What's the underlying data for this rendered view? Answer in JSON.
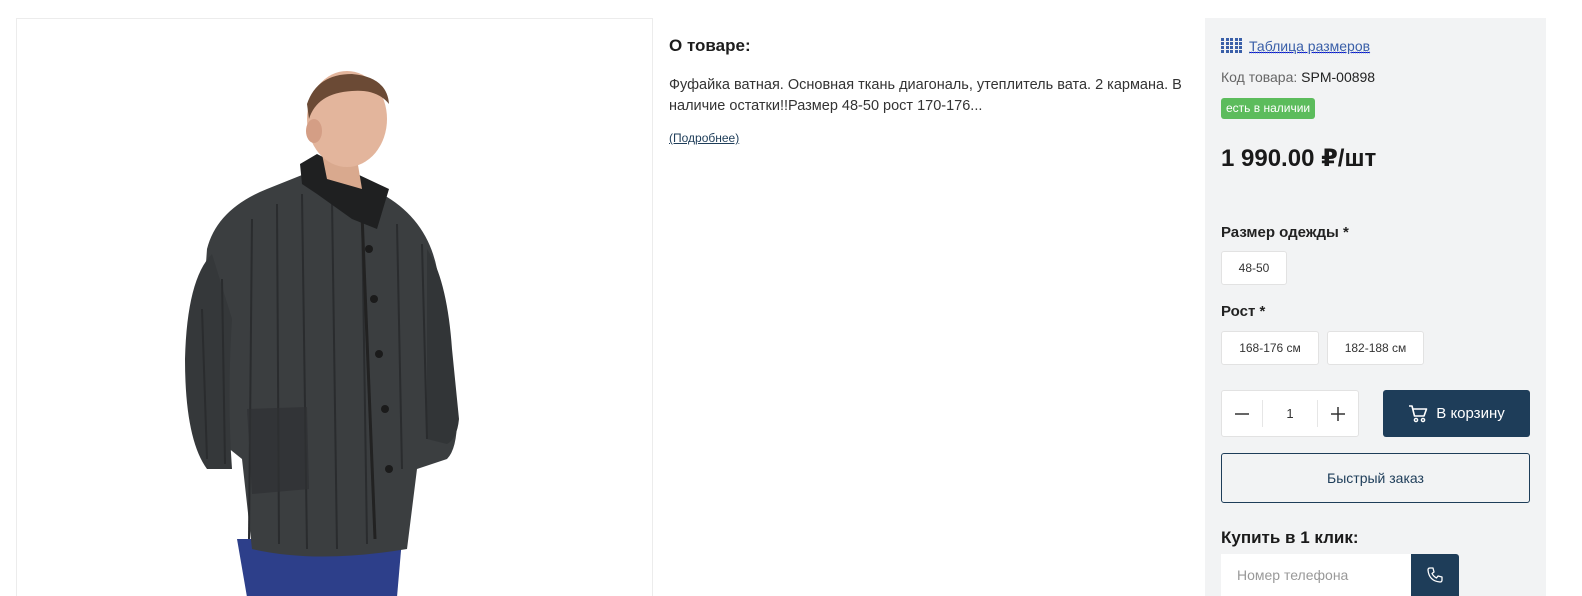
{
  "product_image": {
    "alt": ""
  },
  "about": {
    "title": "О товаре:",
    "text": "Фуфайка ватная. Основная ткань диагональ, утеплитель вата. 2 кармана. В наличие остатки!!Размер 48-50 рост 170-176...",
    "more_link": "(Подробнее)"
  },
  "panel": {
    "size_table_link": "Таблица размеров",
    "size_table_icon": "grid-icon",
    "sku_label": "Код товара:",
    "sku_value": "SPM-00898",
    "stock_badge": "есть в наличии",
    "price": "1 990.00 ₽/шт",
    "size_label": "Размер одежды *",
    "sizes": [
      "48-50"
    ],
    "height_label": "Рост *",
    "heights": [
      "168-176 см",
      "182-188 см"
    ],
    "quantity": "1",
    "cart_button": "В корзину",
    "cart_icon": "cart-icon",
    "quick_order_button": "Быстрый заказ",
    "one_click_title": "Купить в 1 клик:",
    "phone_placeholder": "Номер телефона",
    "phone_icon": "phone-icon"
  },
  "colors": {
    "accent": "#1e3d59",
    "link": "#3a5fa8",
    "stock": "#5cbc5c",
    "panel_bg": "#f2f3f4"
  }
}
